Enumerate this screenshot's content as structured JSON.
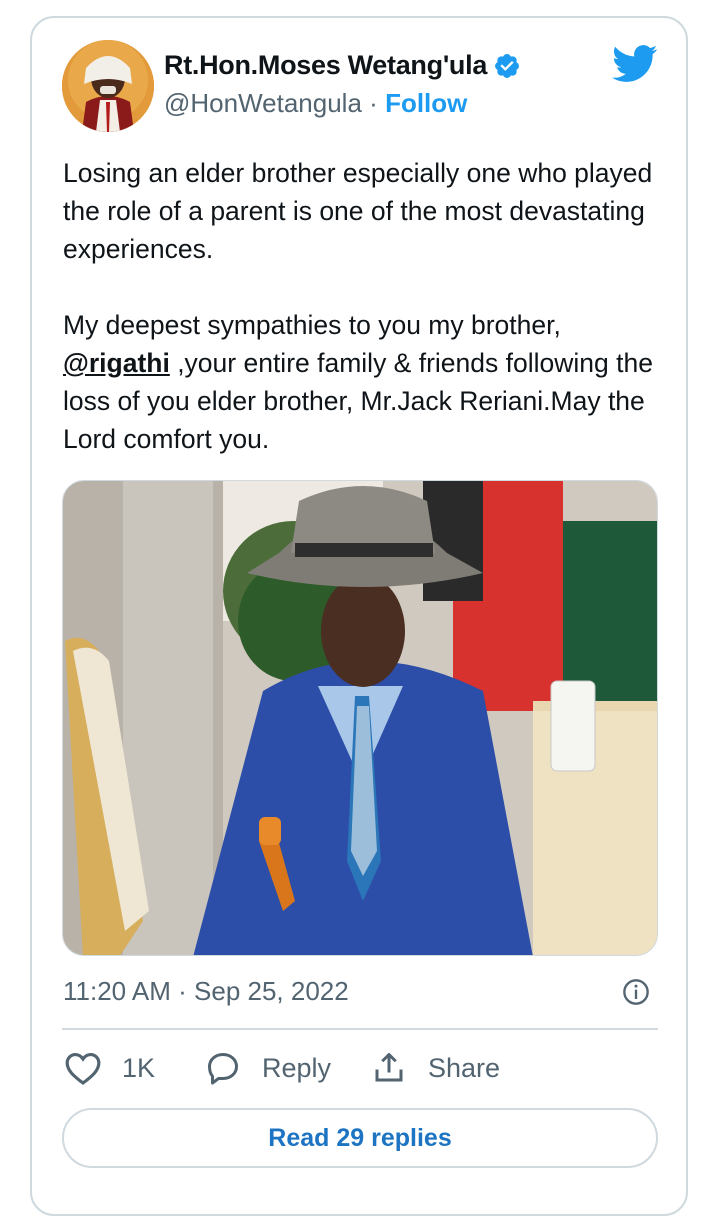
{
  "tweet": {
    "author_name": "Rt.Hon.Moses Wetang'ula",
    "handle": "@HonWetangula",
    "separator": "·",
    "follow_label": "Follow",
    "text_p1": "Losing an elder brother especially one who played the role of a parent is one of the most devastating experiences.",
    "text_p2_pre": "My deepest sympathies to you my brother, ",
    "mention": "@rigathi",
    "text_p2_post": " ,your entire family & friends following the loss of you elder brother, Mr.Jack Reriani.May the Lord comfort you.",
    "timestamp": "11:20 AM · Sep 25, 2022"
  },
  "actions": {
    "like_count": "1K",
    "reply_label": "Reply",
    "share_label": "Share"
  },
  "read_replies_label": "Read 29 replies",
  "icons": [
    "verified-badge-icon",
    "twitter-bird-icon",
    "info-icon",
    "heart-icon",
    "reply-bubble-icon",
    "share-icon"
  ],
  "colors": {
    "accent": "#1d9bf0",
    "link_button": "#1d74c2",
    "muted": "#536471",
    "border": "#cfd9de"
  }
}
